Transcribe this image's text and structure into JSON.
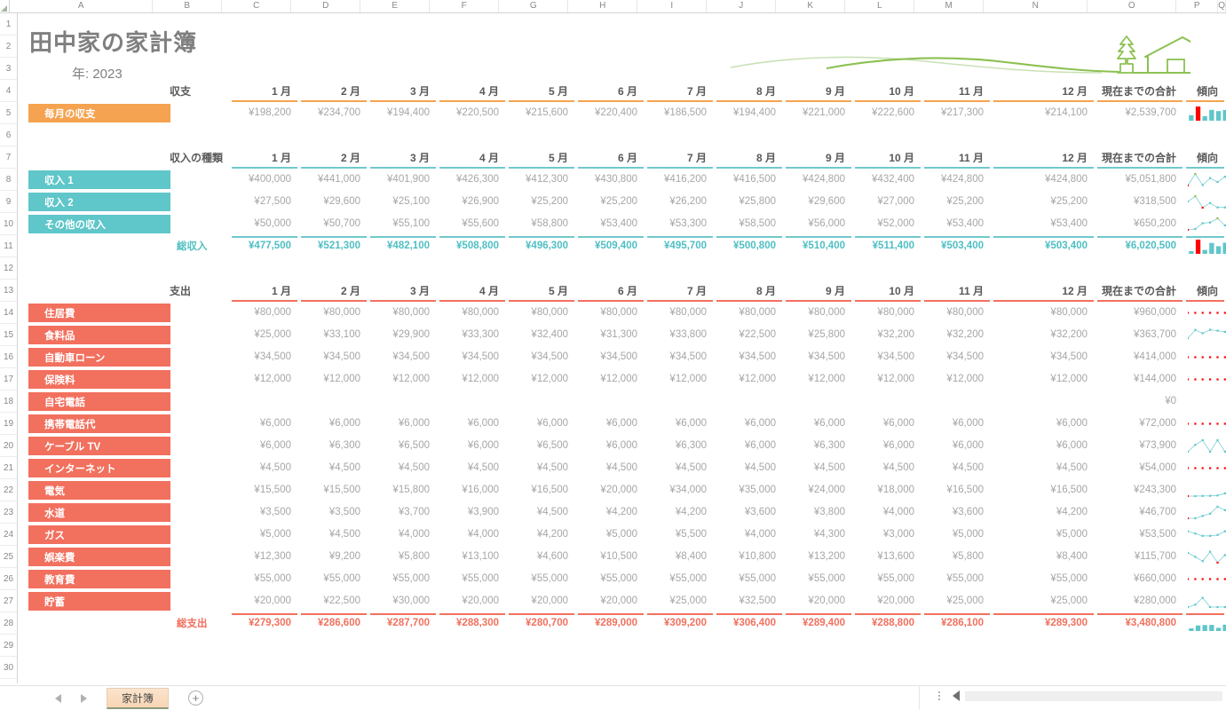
{
  "app": {
    "title": "田中家の家計簿",
    "year_label": "年: 2023",
    "trend_header": "傾向",
    "total_header": "現在までの合計",
    "sheet_tab": "家計簿",
    "add_sheet_icon": "plus-icon",
    "artwork_icon": "house-and-tree-landscape-icon",
    "corner_icon": "select-all-triangle-icon"
  },
  "colors": {
    "orange": "#F5A350",
    "teal": "#5FC6C9",
    "teal_text": "#4FBFC3",
    "red": "#F2705E",
    "value_gray": "#A6A6A6",
    "header_gray": "#595959",
    "title_gray": "#7F7F7F",
    "artwork_green": "#8CC152",
    "spark_bar": "#5FC6C9",
    "spark_negative": "#FF0000",
    "spark_line": "#7FCFD6",
    "spark_marker_high": "#8CC152",
    "spark_marker_low": "#FF0000"
  },
  "columns": [
    "A",
    "B",
    "C",
    "D",
    "E",
    "F",
    "G",
    "H",
    "I",
    "J",
    "K",
    "L",
    "M",
    "N",
    "O",
    "P",
    "Q"
  ],
  "rows": [
    1,
    2,
    3,
    4,
    5,
    6,
    7,
    8,
    9,
    10,
    11,
    12,
    13,
    14,
    15,
    16,
    17,
    18,
    19,
    20,
    21,
    22,
    23,
    24,
    25,
    26,
    27,
    28,
    29,
    30
  ],
  "months": [
    "1 月",
    "2 月",
    "3 月",
    "4 月",
    "5 月",
    "6 月",
    "7 月",
    "8 月",
    "9 月",
    "10 月",
    "11 月",
    "12 月"
  ],
  "sections": {
    "balance": {
      "header": "収支",
      "rows": [
        {
          "label": "毎月の収支",
          "values": [
            "¥198,200",
            "¥234,700",
            "¥194,400",
            "¥220,500",
            "¥215,600",
            "¥220,400",
            "¥186,500",
            "¥194,400",
            "¥221,000",
            "¥222,600",
            "¥217,300",
            "¥214,100"
          ],
          "total": "¥2,539,700"
        }
      ]
    },
    "income": {
      "header": "収入の種類",
      "rows": [
        {
          "label": "収入 1",
          "values": [
            "¥400,000",
            "¥441,000",
            "¥401,900",
            "¥426,300",
            "¥412,300",
            "¥430,800",
            "¥416,200",
            "¥416,500",
            "¥424,800",
            "¥432,400",
            "¥424,800",
            "¥424,800"
          ],
          "total": "¥5,051,800"
        },
        {
          "label": "収入 2",
          "values": [
            "¥27,500",
            "¥29,600",
            "¥25,100",
            "¥26,900",
            "¥25,200",
            "¥25,200",
            "¥26,200",
            "¥25,800",
            "¥29,600",
            "¥27,000",
            "¥25,200",
            "¥25,200"
          ],
          "total": "¥318,500"
        },
        {
          "label": "その他の収入",
          "values": [
            "¥50,000",
            "¥50,700",
            "¥55,100",
            "¥55,600",
            "¥58,800",
            "¥53,400",
            "¥53,300",
            "¥58,500",
            "¥56,000",
            "¥52,000",
            "¥53,400",
            "¥53,400"
          ],
          "total": "¥650,200"
        }
      ],
      "total_row": {
        "label": "総収入",
        "values": [
          "¥477,500",
          "¥521,300",
          "¥482,100",
          "¥508,800",
          "¥496,300",
          "¥509,400",
          "¥495,700",
          "¥500,800",
          "¥510,400",
          "¥511,400",
          "¥503,400",
          "¥503,400"
        ],
        "total": "¥6,020,500"
      }
    },
    "expense": {
      "header": "支出",
      "rows": [
        {
          "label": "住居費",
          "values": [
            "¥80,000",
            "¥80,000",
            "¥80,000",
            "¥80,000",
            "¥80,000",
            "¥80,000",
            "¥80,000",
            "¥80,000",
            "¥80,000",
            "¥80,000",
            "¥80,000",
            "¥80,000"
          ],
          "total": "¥960,000"
        },
        {
          "label": "食料品",
          "values": [
            "¥25,000",
            "¥33,100",
            "¥29,900",
            "¥33,300",
            "¥32,400",
            "¥31,300",
            "¥33,800",
            "¥22,500",
            "¥25,800",
            "¥32,200",
            "¥32,200",
            "¥32,200"
          ],
          "total": "¥363,700"
        },
        {
          "label": "自動車ローン",
          "values": [
            "¥34,500",
            "¥34,500",
            "¥34,500",
            "¥34,500",
            "¥34,500",
            "¥34,500",
            "¥34,500",
            "¥34,500",
            "¥34,500",
            "¥34,500",
            "¥34,500",
            "¥34,500"
          ],
          "total": "¥414,000"
        },
        {
          "label": "保険料",
          "values": [
            "¥12,000",
            "¥12,000",
            "¥12,000",
            "¥12,000",
            "¥12,000",
            "¥12,000",
            "¥12,000",
            "¥12,000",
            "¥12,000",
            "¥12,000",
            "¥12,000",
            "¥12,000"
          ],
          "total": "¥144,000"
        },
        {
          "label": "自宅電話",
          "values": [
            "",
            "",
            "",
            "",
            "",
            "",
            "",
            "",
            "",
            "",
            "",
            ""
          ],
          "total": "¥0"
        },
        {
          "label": "携帯電話代",
          "values": [
            "¥6,000",
            "¥6,000",
            "¥6,000",
            "¥6,000",
            "¥6,000",
            "¥6,000",
            "¥6,000",
            "¥6,000",
            "¥6,000",
            "¥6,000",
            "¥6,000",
            "¥6,000"
          ],
          "total": "¥72,000"
        },
        {
          "label": "ケーブル TV",
          "values": [
            "¥6,000",
            "¥6,300",
            "¥6,500",
            "¥6,000",
            "¥6,500",
            "¥6,000",
            "¥6,300",
            "¥6,000",
            "¥6,300",
            "¥6,000",
            "¥6,000",
            "¥6,000"
          ],
          "total": "¥73,900"
        },
        {
          "label": "インターネット",
          "values": [
            "¥4,500",
            "¥4,500",
            "¥4,500",
            "¥4,500",
            "¥4,500",
            "¥4,500",
            "¥4,500",
            "¥4,500",
            "¥4,500",
            "¥4,500",
            "¥4,500",
            "¥4,500"
          ],
          "total": "¥54,000"
        },
        {
          "label": "電気",
          "values": [
            "¥15,500",
            "¥15,500",
            "¥15,800",
            "¥16,000",
            "¥16,500",
            "¥20,000",
            "¥34,000",
            "¥35,000",
            "¥24,000",
            "¥18,000",
            "¥16,500",
            "¥16,500"
          ],
          "total": "¥243,300"
        },
        {
          "label": "水道",
          "values": [
            "¥3,500",
            "¥3,500",
            "¥3,700",
            "¥3,900",
            "¥4,500",
            "¥4,200",
            "¥4,200",
            "¥3,600",
            "¥3,800",
            "¥4,000",
            "¥3,600",
            "¥4,200"
          ],
          "total": "¥46,700"
        },
        {
          "label": "ガス",
          "values": [
            "¥5,000",
            "¥4,500",
            "¥4,000",
            "¥4,000",
            "¥4,200",
            "¥5,000",
            "¥5,500",
            "¥4,000",
            "¥4,300",
            "¥3,000",
            "¥5,000",
            "¥5,000"
          ],
          "total": "¥53,500"
        },
        {
          "label": "娯楽費",
          "values": [
            "¥12,300",
            "¥9,200",
            "¥5,800",
            "¥13,100",
            "¥4,600",
            "¥10,500",
            "¥8,400",
            "¥10,800",
            "¥13,200",
            "¥13,600",
            "¥5,800",
            "¥8,400"
          ],
          "total": "¥115,700"
        },
        {
          "label": "教育費",
          "values": [
            "¥55,000",
            "¥55,000",
            "¥55,000",
            "¥55,000",
            "¥55,000",
            "¥55,000",
            "¥55,000",
            "¥55,000",
            "¥55,000",
            "¥55,000",
            "¥55,000",
            "¥55,000"
          ],
          "total": "¥660,000"
        },
        {
          "label": "貯蓄",
          "values": [
            "¥20,000",
            "¥22,500",
            "¥30,000",
            "¥20,000",
            "¥20,000",
            "¥20,000",
            "¥25,000",
            "¥32,500",
            "¥20,000",
            "¥20,000",
            "¥25,000",
            "¥25,000"
          ],
          "total": "¥280,000"
        }
      ],
      "total_row": {
        "label": "総支出",
        "values": [
          "¥279,300",
          "¥286,600",
          "¥287,700",
          "¥288,300",
          "¥280,700",
          "¥289,000",
          "¥309,200",
          "¥306,400",
          "¥289,400",
          "¥288,800",
          "¥286,100",
          "¥289,300"
        ],
        "total": "¥3,480,800"
      }
    }
  },
  "chart_data": [
    {
      "type": "bar",
      "name": "毎月の収支 傾向",
      "categories": [
        "1 月",
        "2 月",
        "3 月",
        "4 月",
        "5 月",
        "6 月",
        "7 月",
        "8 月",
        "9 月",
        "10 月",
        "11 月",
        "12 月"
      ],
      "values": [
        198200,
        234700,
        194400,
        220500,
        215600,
        220400,
        186500,
        194400,
        221000,
        222600,
        217300,
        214100
      ],
      "highlight_index": 1,
      "highlight_color": "#FF0000",
      "bar_color": "#5FC6C9"
    },
    {
      "type": "line",
      "name": "収入 1 傾向",
      "categories": [
        "1 月",
        "2 月",
        "3 月",
        "4 月",
        "5 月",
        "6 月",
        "7 月",
        "8 月",
        "9 月",
        "10 月",
        "11 月",
        "12 月"
      ],
      "values": [
        400000,
        441000,
        401900,
        426300,
        412300,
        430800,
        416200,
        416500,
        424800,
        432400,
        424800,
        424800
      ],
      "low_index": 0,
      "high_index": 1,
      "line_color": "#7FCFD6"
    },
    {
      "type": "line",
      "name": "収入 2 傾向",
      "categories": [
        "1 月",
        "2 月",
        "3 月",
        "4 月",
        "5 月",
        "6 月",
        "7 月",
        "8 月",
        "9 月",
        "10 月",
        "11 月",
        "12 月"
      ],
      "values": [
        27500,
        29600,
        25100,
        26900,
        25200,
        25200,
        26200,
        25800,
        29600,
        27000,
        25200,
        25200
      ],
      "low_index": 2,
      "high_index": 1,
      "line_color": "#7FCFD6"
    },
    {
      "type": "line",
      "name": "その他の収入 傾向",
      "categories": [
        "1 月",
        "2 月",
        "3 月",
        "4 月",
        "5 月",
        "6 月",
        "7 月",
        "8 月",
        "9 月",
        "10 月",
        "11 月",
        "12 月"
      ],
      "values": [
        50000,
        50700,
        55100,
        55600,
        58800,
        53400,
        53300,
        58500,
        56000,
        52000,
        53400,
        53400
      ],
      "low_index": 0,
      "high_index": 4,
      "line_color": "#7FCFD6"
    },
    {
      "type": "bar",
      "name": "総収入 傾向",
      "categories": [
        "1 月",
        "2 月",
        "3 月",
        "4 月",
        "5 月",
        "6 月",
        "7 月",
        "8 月",
        "9 月",
        "10 月",
        "11 月",
        "12 月"
      ],
      "values": [
        477500,
        521300,
        482100,
        508800,
        496300,
        509400,
        495700,
        500800,
        510400,
        511400,
        503400,
        503400
      ],
      "highlight_index": 1,
      "highlight_color": "#FF0000",
      "bar_color": "#5FC6C9"
    },
    {
      "type": "line",
      "name": "住居費 傾向",
      "categories": [
        "1 月",
        "2 月",
        "3 月",
        "4 月",
        "5 月",
        "6 月",
        "7 月",
        "8 月",
        "9 月",
        "10 月",
        "11 月",
        "12 月"
      ],
      "values": [
        80000,
        80000,
        80000,
        80000,
        80000,
        80000,
        80000,
        80000,
        80000,
        80000,
        80000,
        80000
      ],
      "flat": true,
      "line_color": "#FF0000"
    },
    {
      "type": "line",
      "name": "食料品 傾向",
      "categories": [
        "1 月",
        "2 月",
        "3 月",
        "4 月",
        "5 月",
        "6 月",
        "7 月",
        "8 月",
        "9 月",
        "10 月",
        "11 月",
        "12 月"
      ],
      "values": [
        25000,
        33100,
        29900,
        33300,
        32400,
        31300,
        33800,
        22500,
        25800,
        32200,
        32200,
        32200
      ],
      "low_index": 7,
      "line_color": "#7FCFD6"
    },
    {
      "type": "line",
      "name": "自動車ローン 傾向",
      "categories": [
        "1 月",
        "2 月",
        "3 月",
        "4 月",
        "5 月",
        "6 月",
        "7 月",
        "8 月",
        "9 月",
        "10 月",
        "11 月",
        "12 月"
      ],
      "values": [
        34500,
        34500,
        34500,
        34500,
        34500,
        34500,
        34500,
        34500,
        34500,
        34500,
        34500,
        34500
      ],
      "flat": true,
      "line_color": "#FF0000"
    },
    {
      "type": "line",
      "name": "保険料 傾向",
      "categories": [
        "1 月",
        "2 月",
        "3 月",
        "4 月",
        "5 月",
        "6 月",
        "7 月",
        "8 月",
        "9 月",
        "10 月",
        "11 月",
        "12 月"
      ],
      "values": [
        12000,
        12000,
        12000,
        12000,
        12000,
        12000,
        12000,
        12000,
        12000,
        12000,
        12000,
        12000
      ],
      "flat": true,
      "line_color": "#FF0000"
    },
    {
      "type": "line",
      "name": "携帯電話代 傾向",
      "categories": [
        "1 月",
        "2 月",
        "3 月",
        "4 月",
        "5 月",
        "6 月",
        "7 月",
        "8 月",
        "9 月",
        "10 月",
        "11 月",
        "12 月"
      ],
      "values": [
        6000,
        6000,
        6000,
        6000,
        6000,
        6000,
        6000,
        6000,
        6000,
        6000,
        6000,
        6000
      ],
      "flat": true,
      "line_color": "#FF0000"
    },
    {
      "type": "line",
      "name": "ケーブル TV 傾向",
      "categories": [
        "1 月",
        "2 月",
        "3 月",
        "4 月",
        "5 月",
        "6 月",
        "7 月",
        "8 月",
        "9 月",
        "10 月",
        "11 月",
        "12 月"
      ],
      "values": [
        6000,
        6300,
        6500,
        6000,
        6500,
        6000,
        6300,
        6000,
        6300,
        6000,
        6000,
        6000
      ],
      "line_color": "#7FCFD6"
    },
    {
      "type": "line",
      "name": "インターネット 傾向",
      "categories": [
        "1 月",
        "2 月",
        "3 月",
        "4 月",
        "5 月",
        "6 月",
        "7 月",
        "8 月",
        "9 月",
        "10 月",
        "11 月",
        "12 月"
      ],
      "values": [
        4500,
        4500,
        4500,
        4500,
        4500,
        4500,
        4500,
        4500,
        4500,
        4500,
        4500,
        4500
      ],
      "flat": true,
      "line_color": "#FF0000"
    },
    {
      "type": "line",
      "name": "電気 傾向",
      "categories": [
        "1 月",
        "2 月",
        "3 月",
        "4 月",
        "5 月",
        "6 月",
        "7 月",
        "8 月",
        "9 月",
        "10 月",
        "11 月",
        "12 月"
      ],
      "values": [
        15500,
        15500,
        15800,
        16000,
        16500,
        20000,
        34000,
        35000,
        24000,
        18000,
        16500,
        16500
      ],
      "low_index": 0,
      "high_index": 7,
      "line_color": "#7FCFD6"
    },
    {
      "type": "line",
      "name": "水道 傾向",
      "categories": [
        "1 月",
        "2 月",
        "3 月",
        "4 月",
        "5 月",
        "6 月",
        "7 月",
        "8 月",
        "9 月",
        "10 月",
        "11 月",
        "12 月"
      ],
      "values": [
        3500,
        3500,
        3700,
        3900,
        4500,
        4200,
        4200,
        3600,
        3800,
        4000,
        3600,
        4200
      ],
      "low_index": 0,
      "line_color": "#7FCFD6"
    },
    {
      "type": "line",
      "name": "ガス 傾向",
      "categories": [
        "1 月",
        "2 月",
        "3 月",
        "4 月",
        "5 月",
        "6 月",
        "7 月",
        "8 月",
        "9 月",
        "10 月",
        "11 月",
        "12 月"
      ],
      "values": [
        5000,
        4500,
        4000,
        4000,
        4200,
        5000,
        5500,
        4000,
        4300,
        3000,
        5000,
        5000
      ],
      "low_index": 9,
      "line_color": "#7FCFD6"
    },
    {
      "type": "line",
      "name": "娯楽費 傾向",
      "categories": [
        "1 月",
        "2 月",
        "3 月",
        "4 月",
        "5 月",
        "6 月",
        "7 月",
        "8 月",
        "9 月",
        "10 月",
        "11 月",
        "12 月"
      ],
      "values": [
        12300,
        9200,
        5800,
        13100,
        4600,
        10500,
        8400,
        10800,
        13200,
        13600,
        5800,
        8400
      ],
      "low_index": 4,
      "line_color": "#7FCFD6"
    },
    {
      "type": "line",
      "name": "教育費 傾向",
      "categories": [
        "1 月",
        "2 月",
        "3 月",
        "4 月",
        "5 月",
        "6 月",
        "7 月",
        "8 月",
        "9 月",
        "10 月",
        "11 月",
        "12 月"
      ],
      "values": [
        55000,
        55000,
        55000,
        55000,
        55000,
        55000,
        55000,
        55000,
        55000,
        55000,
        55000,
        55000
      ],
      "flat": true,
      "line_color": "#FF0000"
    },
    {
      "type": "line",
      "name": "貯蓄 傾向",
      "categories": [
        "1 月",
        "2 月",
        "3 月",
        "4 月",
        "5 月",
        "6 月",
        "7 月",
        "8 月",
        "9 月",
        "10 月",
        "11 月",
        "12 月"
      ],
      "values": [
        20000,
        22500,
        30000,
        20000,
        20000,
        20000,
        25000,
        32500,
        20000,
        20000,
        25000,
        25000
      ],
      "line_color": "#7FCFD6"
    },
    {
      "type": "bar",
      "name": "総支出 傾向",
      "categories": [
        "1 月",
        "2 月",
        "3 月",
        "4 月",
        "5 月",
        "6 月",
        "7 月",
        "8 月",
        "9 月",
        "10 月",
        "11 月",
        "12 月"
      ],
      "values": [
        279300,
        286600,
        287700,
        288300,
        280700,
        289000,
        309200,
        306400,
        289400,
        288800,
        286100,
        289300
      ],
      "highlight_index": 6,
      "highlight_color": "#FF0000",
      "bar_color": "#5FC6C9"
    }
  ]
}
